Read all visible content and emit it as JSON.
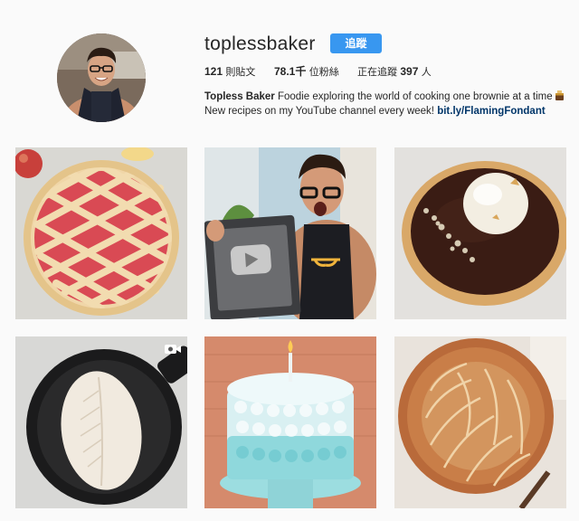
{
  "profile": {
    "username": "toplessbaker",
    "follow_label": "追蹤",
    "stats": {
      "posts_count": "121",
      "posts_label": "則貼文",
      "followers_count": "78.1千",
      "followers_label": "位粉絲",
      "following_label": "正在追蹤",
      "following_count": "397",
      "following_unit": "人"
    },
    "bio": {
      "name": "Topless Baker",
      "line1": "Foodie exploring the world of cooking one brownie at a time",
      "line2": "New recipes on my YouTube channel every week!",
      "link": "bit.ly/FlamingFondant"
    },
    "avatar_icon": "profile-photo"
  },
  "colors": {
    "accent": "#3897f0",
    "link": "#003569",
    "background": "#fafafa"
  },
  "posts": [
    {
      "kind": "image",
      "subject": "lattice berry pie"
    },
    {
      "kind": "image",
      "subject": "youtube silver play button award"
    },
    {
      "kind": "image",
      "subject": "chocolate tart with ice cream"
    },
    {
      "kind": "video",
      "subject": "bread dough in cast iron pan",
      "badge_icon": "video-camera-icon"
    },
    {
      "kind": "image",
      "subject": "ombre ruffle birthday cake"
    },
    {
      "kind": "image",
      "subject": "scored sourdough loaf"
    }
  ]
}
